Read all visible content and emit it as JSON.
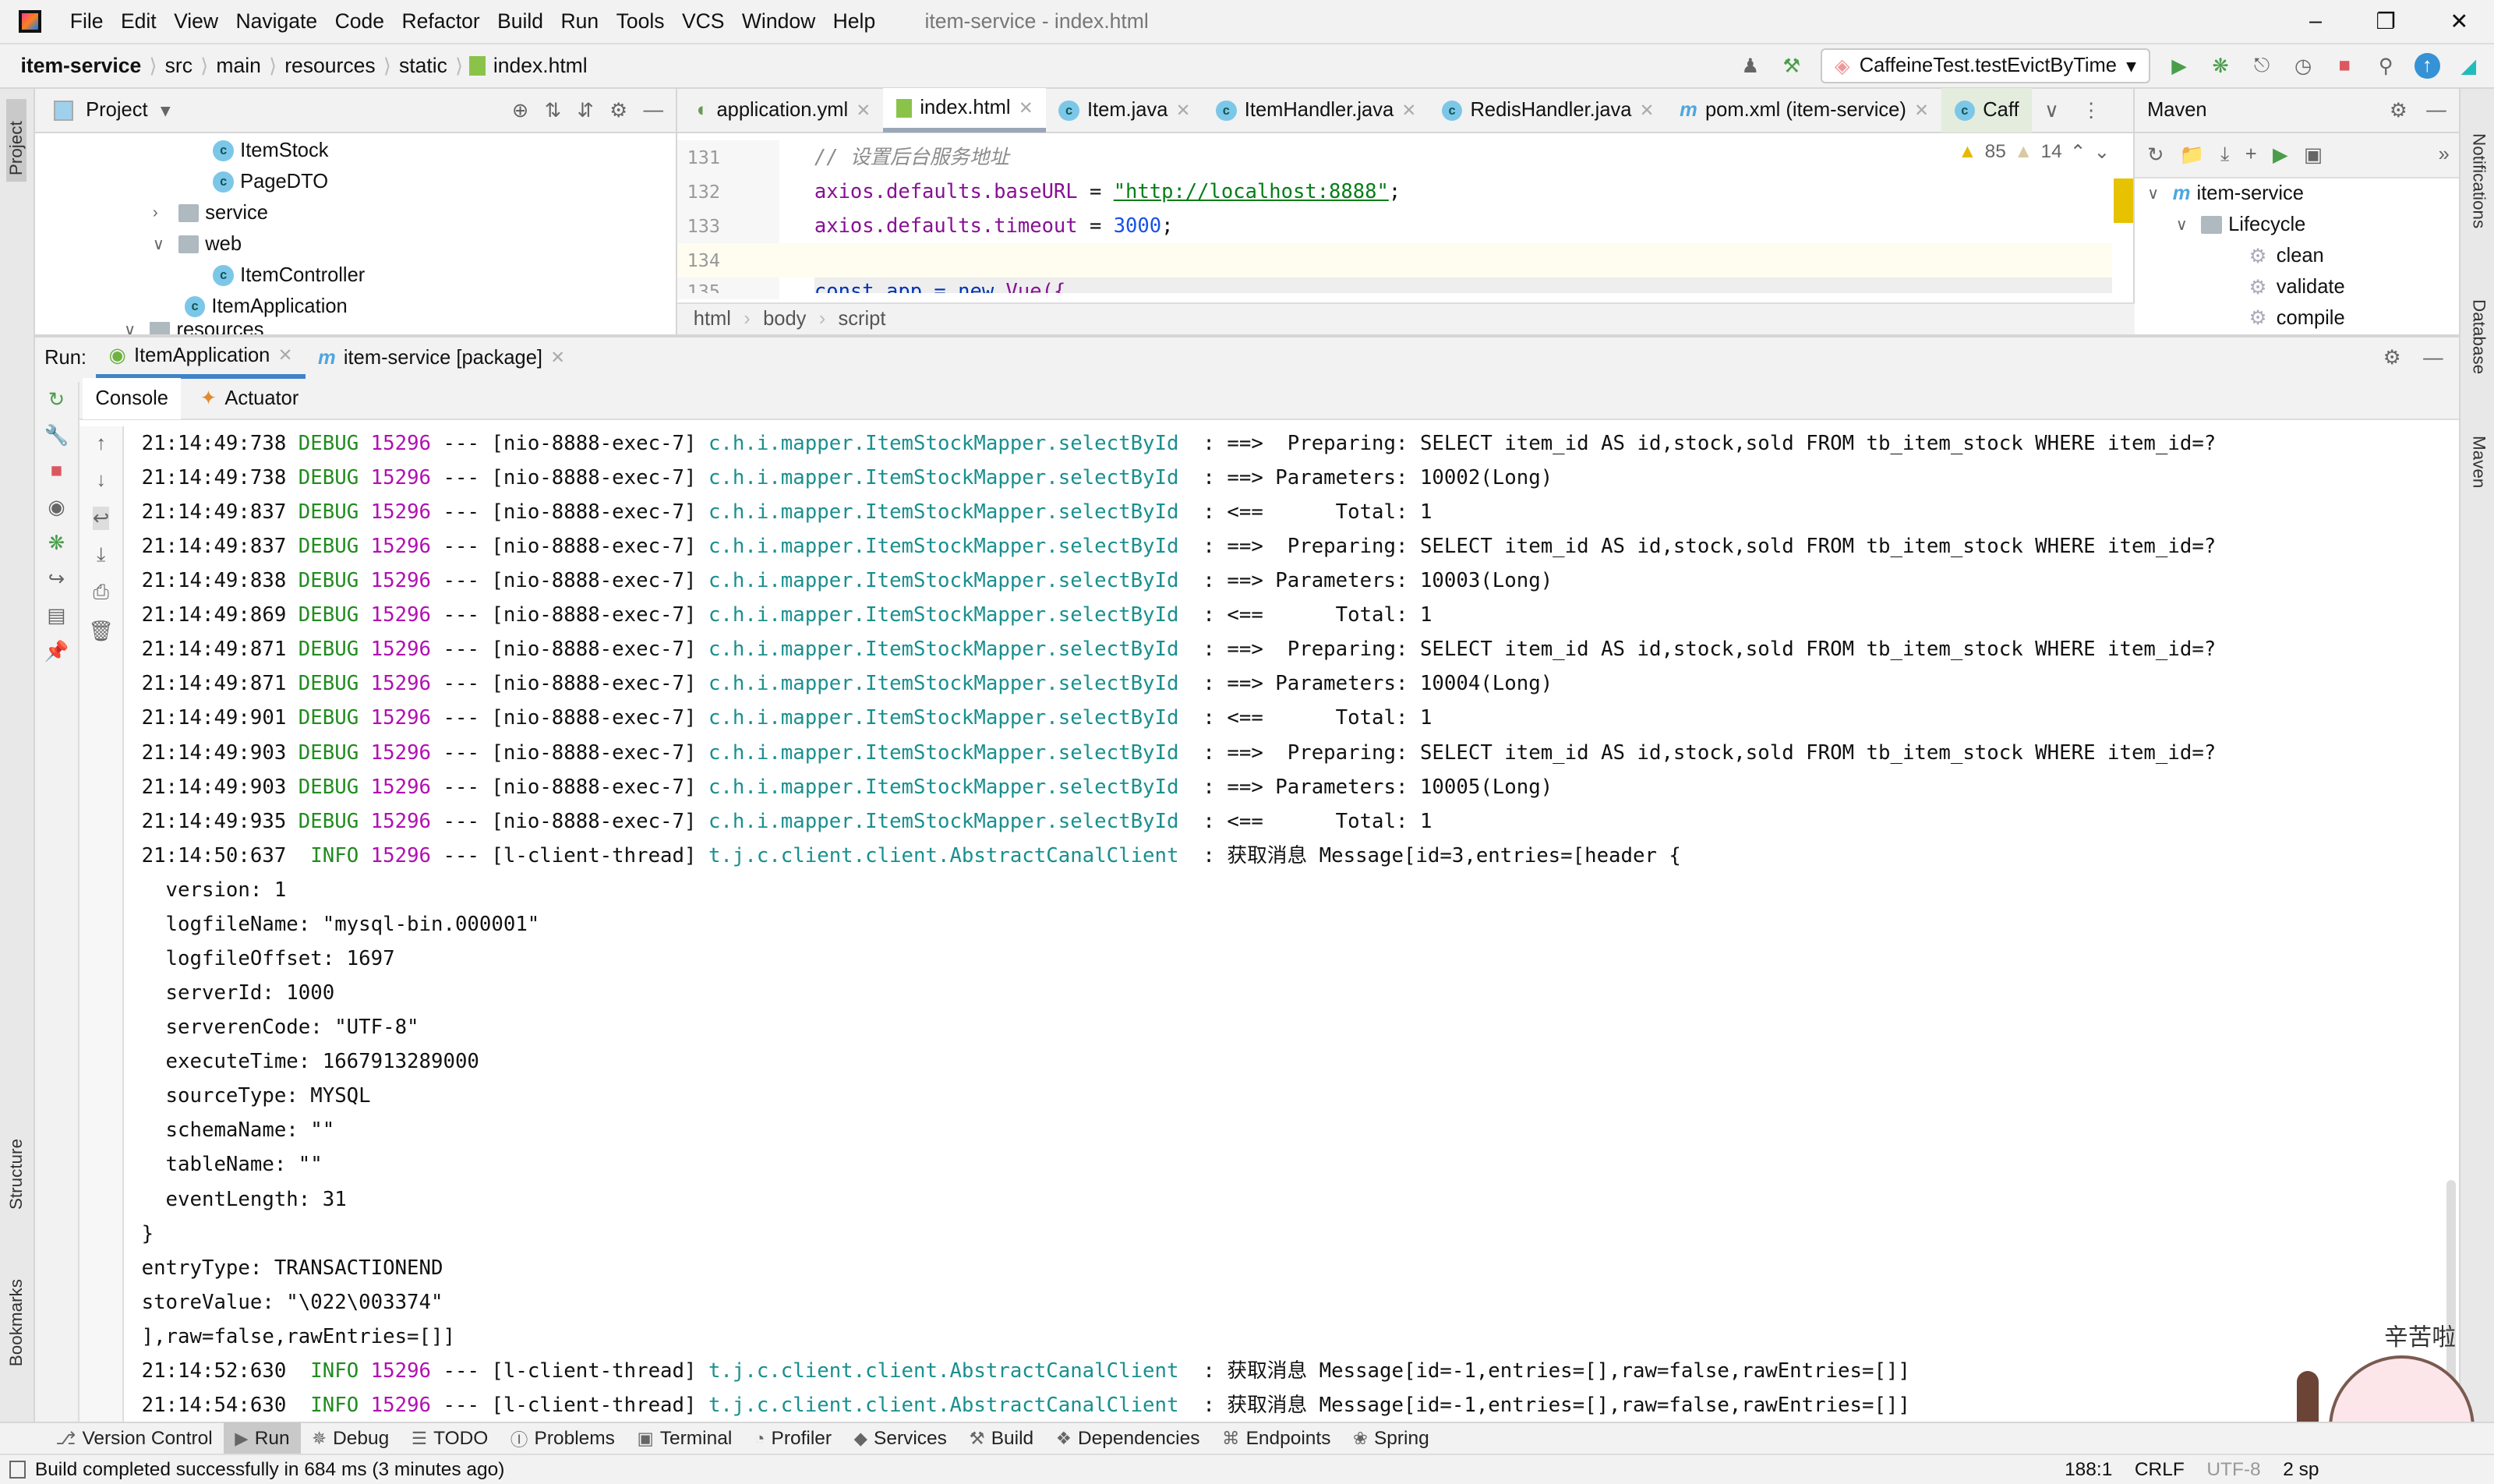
{
  "window": {
    "title": "item-service - index.html",
    "menu": [
      "File",
      "Edit",
      "View",
      "Navigate",
      "Code",
      "Refactor",
      "Build",
      "Run",
      "Tools",
      "VCS",
      "Window",
      "Help"
    ]
  },
  "breadcrumb": [
    "item-service",
    "src",
    "main",
    "resources",
    "static",
    "index.html"
  ],
  "run_config": {
    "label": "CaffeineTest.testEvictByTime"
  },
  "project": {
    "title": "Project",
    "items": [
      {
        "label": "ItemStock",
        "type": "class",
        "depth": 3
      },
      {
        "label": "PageDTO",
        "type": "class",
        "depth": 3
      },
      {
        "label": "service",
        "type": "folder",
        "depth": 2,
        "expanded": false
      },
      {
        "label": "web",
        "type": "folder",
        "depth": 2,
        "expanded": true
      },
      {
        "label": "ItemController",
        "type": "class",
        "depth": 3
      },
      {
        "label": "ItemApplication",
        "type": "app",
        "depth": 2
      },
      {
        "label": "resources",
        "type": "folder",
        "depth": 1,
        "expanded": true
      }
    ]
  },
  "editor": {
    "tabs": [
      {
        "label": "application.yml"
      },
      {
        "label": "index.html",
        "active": true
      },
      {
        "label": "Item.java"
      },
      {
        "label": "ItemHandler.java"
      },
      {
        "label": "RedisHandler.java"
      },
      {
        "label": "pom.xml (item-service)"
      },
      {
        "label": "Caff"
      }
    ],
    "warnings": "85",
    "weak_warnings": "14",
    "line_numbers": [
      "131",
      "132",
      "133",
      "134",
      "135"
    ],
    "lines": {
      "l131": "// 设置后台服务地址",
      "l132_a": "axios.defaults.baseURL",
      "l132_eq": " = ",
      "l132_str": "\"http://localhost:8888\"",
      "l132_end": ";",
      "l133_a": "axios.defaults.timeout",
      "l133_eq": " = ",
      "l133_num": "3000",
      "l133_end": ";",
      "l135_a": "const app = ",
      "l135_b": "new ",
      "l135_c": "Vue({"
    },
    "crumbs": [
      "html",
      "body",
      "script"
    ]
  },
  "maven": {
    "title": "Maven",
    "items": [
      {
        "label": "item-service",
        "depth": 0
      },
      {
        "label": "Lifecycle",
        "depth": 1
      },
      {
        "label": "clean",
        "depth": 2
      },
      {
        "label": "validate",
        "depth": 2
      },
      {
        "label": "compile",
        "depth": 2
      }
    ]
  },
  "run": {
    "label": "Run:",
    "tabs": [
      {
        "label": "ItemApplication",
        "active": true
      },
      {
        "label": "item-service [package]"
      }
    ],
    "subtabs": [
      "Console",
      "Actuator"
    ]
  },
  "console": [
    {
      "ts": "21:14:49:738",
      "lvl": "DEBUG",
      "pid": "15296",
      "thread": " --- [nio-8888-exec-7] ",
      "logger": "c.h.i.mapper.ItemStockMapper.selectById",
      "msg": "  : ==>  Preparing: SELECT item_id AS id,stock,sold FROM tb_item_stock WHERE item_id=?"
    },
    {
      "ts": "21:14:49:738",
      "lvl": "DEBUG",
      "pid": "15296",
      "thread": " --- [nio-8888-exec-7] ",
      "logger": "c.h.i.mapper.ItemStockMapper.selectById",
      "msg": "  : ==> Parameters: 10002(Long)"
    },
    {
      "ts": "21:14:49:837",
      "lvl": "DEBUG",
      "pid": "15296",
      "thread": " --- [nio-8888-exec-7] ",
      "logger": "c.h.i.mapper.ItemStockMapper.selectById",
      "msg": "  : <==      Total: 1"
    },
    {
      "ts": "21:14:49:837",
      "lvl": "DEBUG",
      "pid": "15296",
      "thread": " --- [nio-8888-exec-7] ",
      "logger": "c.h.i.mapper.ItemStockMapper.selectById",
      "msg": "  : ==>  Preparing: SELECT item_id AS id,stock,sold FROM tb_item_stock WHERE item_id=?"
    },
    {
      "ts": "21:14:49:838",
      "lvl": "DEBUG",
      "pid": "15296",
      "thread": " --- [nio-8888-exec-7] ",
      "logger": "c.h.i.mapper.ItemStockMapper.selectById",
      "msg": "  : ==> Parameters: 10003(Long)"
    },
    {
      "ts": "21:14:49:869",
      "lvl": "DEBUG",
      "pid": "15296",
      "thread": " --- [nio-8888-exec-7] ",
      "logger": "c.h.i.mapper.ItemStockMapper.selectById",
      "msg": "  : <==      Total: 1"
    },
    {
      "ts": "21:14:49:871",
      "lvl": "DEBUG",
      "pid": "15296",
      "thread": " --- [nio-8888-exec-7] ",
      "logger": "c.h.i.mapper.ItemStockMapper.selectById",
      "msg": "  : ==>  Preparing: SELECT item_id AS id,stock,sold FROM tb_item_stock WHERE item_id=?"
    },
    {
      "ts": "21:14:49:871",
      "lvl": "DEBUG",
      "pid": "15296",
      "thread": " --- [nio-8888-exec-7] ",
      "logger": "c.h.i.mapper.ItemStockMapper.selectById",
      "msg": "  : ==> Parameters: 10004(Long)"
    },
    {
      "ts": "21:14:49:901",
      "lvl": "DEBUG",
      "pid": "15296",
      "thread": " --- [nio-8888-exec-7] ",
      "logger": "c.h.i.mapper.ItemStockMapper.selectById",
      "msg": "  : <==      Total: 1"
    },
    {
      "ts": "21:14:49:903",
      "lvl": "DEBUG",
      "pid": "15296",
      "thread": " --- [nio-8888-exec-7] ",
      "logger": "c.h.i.mapper.ItemStockMapper.selectById",
      "msg": "  : ==>  Preparing: SELECT item_id AS id,stock,sold FROM tb_item_stock WHERE item_id=?"
    },
    {
      "ts": "21:14:49:903",
      "lvl": "DEBUG",
      "pid": "15296",
      "thread": " --- [nio-8888-exec-7] ",
      "logger": "c.h.i.mapper.ItemStockMapper.selectById",
      "msg": "  : ==> Parameters: 10005(Long)"
    },
    {
      "ts": "21:14:49:935",
      "lvl": "DEBUG",
      "pid": "15296",
      "thread": " --- [nio-8888-exec-7] ",
      "logger": "c.h.i.mapper.ItemStockMapper.selectById",
      "msg": "  : <==      Total: 1"
    },
    {
      "ts": "21:14:50:637",
      "lvl": " INFO",
      "pid": "15296",
      "thread": " --- [l-client-thread] ",
      "logger": "t.j.c.client.client.AbstractCanalClient",
      "msg": "  : 获取消息 Message[id=3,entries=[header {"
    },
    {
      "text": "  version: 1"
    },
    {
      "text": "  logfileName: \"mysql-bin.000001\""
    },
    {
      "text": "  logfileOffset: 1697"
    },
    {
      "text": "  serverId: 1000"
    },
    {
      "text": "  serverenCode: \"UTF-8\""
    },
    {
      "text": "  executeTime: 1667913289000"
    },
    {
      "text": "  sourceType: MYSQL"
    },
    {
      "text": "  schemaName: \"\""
    },
    {
      "text": "  tableName: \"\""
    },
    {
      "text": "  eventLength: 31"
    },
    {
      "text": "}"
    },
    {
      "text": "entryType: TRANSACTIONEND"
    },
    {
      "text": "storeValue: \"\\022\\003374\""
    },
    {
      "text": "],raw=false,rawEntries=[]]"
    },
    {
      "ts": "21:14:52:630",
      "lvl": " INFO",
      "pid": "15296",
      "thread": " --- [l-client-thread] ",
      "logger": "t.j.c.client.client.AbstractCanalClient",
      "msg": "  : 获取消息 Message[id=-1,entries=[],raw=false,rawEntries=[]]"
    },
    {
      "ts": "21:14:54:630",
      "lvl": " INFO",
      "pid": "15296",
      "thread": " --- [l-client-thread] ",
      "logger": "t.j.c.client.client.AbstractCanalClient",
      "msg": "  : 获取消息 Message[id=-1,entries=[],raw=false,rawEntries=[]]"
    }
  ],
  "bottom_tabs": [
    {
      "label": "Version Control",
      "icon": "branch-icon"
    },
    {
      "label": "Run",
      "icon": "run-icon",
      "active": true
    },
    {
      "label": "Debug",
      "icon": "bug-icon"
    },
    {
      "label": "TODO",
      "icon": "list-icon"
    },
    {
      "label": "Problems",
      "icon": "problems-icon"
    },
    {
      "label": "Terminal",
      "icon": "terminal-icon"
    },
    {
      "label": "Profiler",
      "icon": "profiler-icon"
    },
    {
      "label": "Services",
      "icon": "services-icon"
    },
    {
      "label": "Build",
      "icon": "hammer-icon"
    },
    {
      "label": "Dependencies",
      "icon": "dependencies-icon"
    },
    {
      "label": "Endpoints",
      "icon": "endpoints-icon"
    },
    {
      "label": "Spring",
      "icon": "spring-icon"
    }
  ],
  "status": {
    "message": "Build completed successfully in 684 ms (3 minutes ago)",
    "position": "188:1",
    "line_sep": "CRLF",
    "encoding": "UTF-8",
    "indent": "2 sp"
  },
  "side": {
    "left_top": "Project",
    "left_bottom": [
      "Structure",
      "Bookmarks"
    ],
    "right": [
      "Notifications",
      "Database",
      "Maven"
    ]
  },
  "sticker": {
    "text": "辛苦啦"
  },
  "colors": {
    "debug": "#218c1f",
    "pid": "#b10fb1",
    "logger": "#1a8f8f",
    "active_tab_underline": "#9aa7b7"
  }
}
